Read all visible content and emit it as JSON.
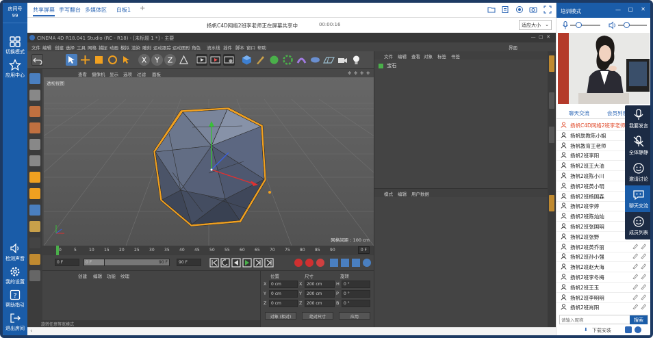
{
  "sidebar": {
    "room_label": "房间号",
    "room_number": "99",
    "items": [
      {
        "label": "切换模式",
        "icon": "grid-icon"
      },
      {
        "label": "应用中心",
        "icon": "star-icon"
      },
      {
        "label": "检测声音",
        "icon": "speaker-icon"
      },
      {
        "label": "我的设置",
        "icon": "gear-icon"
      },
      {
        "label": "帮助指引",
        "icon": "help-icon"
      },
      {
        "label": "退出房间",
        "icon": "exit-icon"
      }
    ]
  },
  "tabs": [
    {
      "label": "共享屏幕",
      "active": true
    },
    {
      "label": "手写翻台",
      "active": false
    },
    {
      "label": "多媒体区",
      "active": false
    },
    {
      "label": "白板1",
      "active": false
    },
    {
      "label": "+",
      "active": false
    }
  ],
  "share": {
    "message": "扬帆C4D网络2班李老师正在屏幕共享中",
    "time": "00:00:16",
    "fit_select": "适应大小"
  },
  "c4d": {
    "title": "CINEMA 4D R18.041 Studio (RC - R18) - [未标题 1 *] - 主要",
    "interface_label": "界面",
    "interface_value": "启动",
    "menu": [
      "文件",
      "编辑",
      "创建",
      "选择",
      "工具",
      "网格",
      "捕捉",
      "动画",
      "模拟",
      "渲染",
      "雕刻",
      "运动跟踪",
      "运动图形",
      "角色",
      "流水线",
      "插件",
      "脚本",
      "窗口",
      "帮助"
    ],
    "viewport_menu": [
      "查看",
      "摄像机",
      "显示",
      "选项",
      "过滤",
      "面板"
    ],
    "viewport_label": "透视视图",
    "grid_label": "网格间距 : 100 cm",
    "timeline_ticks": [
      "0",
      "5",
      "10",
      "15",
      "20",
      "25",
      "30",
      "35",
      "40",
      "45",
      "50",
      "55",
      "60",
      "65",
      "70",
      "75",
      "80",
      "85",
      "90"
    ],
    "frame_end": "0 F",
    "play_start": "0 F",
    "play_cur": "0 F",
    "play_range_end": "90 F",
    "play_end": "90 F",
    "attr_menu": [
      "创建",
      "编辑",
      "功能",
      "纹理"
    ],
    "coord_headers": [
      "位置",
      "尺寸",
      "旋转"
    ],
    "coords": [
      {
        "axis": "X",
        "pos": "0 cm",
        "size": "200 cm",
        "rot_axis": "H",
        "rot": "0 °"
      },
      {
        "axis": "Y",
        "pos": "0 cm",
        "size": "200 cm",
        "rot_axis": "P",
        "rot": "0 °"
      },
      {
        "axis": "Z",
        "pos": "0 cm",
        "size": "200 cm",
        "rot_axis": "B",
        "rot": "0 °"
      }
    ],
    "coord_mode": "对象 (相对)",
    "size_mode": "绝对尺寸",
    "apply_label": "应用",
    "status_text": "旋转任意等宽模式",
    "obj_menu": [
      "文件",
      "编辑",
      "查看",
      "对象",
      "标签",
      "书签"
    ],
    "obj_item": "宝石",
    "attr2_menu": [
      "模式",
      "编辑",
      "用户数据"
    ],
    "right_strip": [
      "对象",
      "内容浏览器",
      "构造",
      "属性"
    ]
  },
  "right": {
    "mode": "培训模式",
    "tabs": [
      "聊天交流",
      "会员列表"
    ],
    "users": [
      {
        "name": "扬帆C4D网络2班李老师",
        "teacher": true
      },
      {
        "name": "扬帆助教陈小姐",
        "teacher": false
      },
      {
        "name": "扬帆教育王老师",
        "teacher": false
      },
      {
        "name": "扬帆2班李阳",
        "teacher": false
      },
      {
        "name": "扬帆2班王大油",
        "teacher": false
      },
      {
        "name": "扬帆2班陈小川",
        "teacher": false
      },
      {
        "name": "扬帆2班黄小明",
        "teacher": false
      },
      {
        "name": "扬帆2班杨国森",
        "teacher": false
      },
      {
        "name": "扬帆2班李婷",
        "teacher": false
      },
      {
        "name": "扬帆2班陈灿灿",
        "teacher": false
      },
      {
        "name": "扬帆2班张国明",
        "teacher": false
      },
      {
        "name": "扬帆2班张野",
        "teacher": false
      },
      {
        "name": "扬帆2班黄乔丽",
        "teacher": false
      },
      {
        "name": "扬帆2班孙小强",
        "teacher": false
      },
      {
        "name": "扬帆2班赵大海",
        "teacher": false
      },
      {
        "name": "扬帆2班李冬梅",
        "teacher": false
      },
      {
        "name": "扬帆2班王玉",
        "teacher": false
      },
      {
        "name": "扬帆2班李明明",
        "teacher": false
      },
      {
        "name": "扬帆2班肖阳",
        "teacher": false
      }
    ],
    "float_buttons": [
      {
        "label": "我要发言",
        "icon": "mic-icon"
      },
      {
        "label": "全体静静",
        "icon": "mute-icon"
      },
      {
        "label": "邀请讨论",
        "icon": "invite-icon"
      },
      {
        "label": "聊天交流",
        "icon": "chat-icon"
      },
      {
        "label": "成员列表",
        "icon": "members-icon"
      }
    ],
    "search_placeholder": "请输入昵称",
    "search_button": "搜索",
    "download_label": "下载安装"
  },
  "colors": {
    "brand": "#1a5ca8",
    "teacher": "#e04a2a",
    "c4d_bg": "#4a4a4a"
  }
}
